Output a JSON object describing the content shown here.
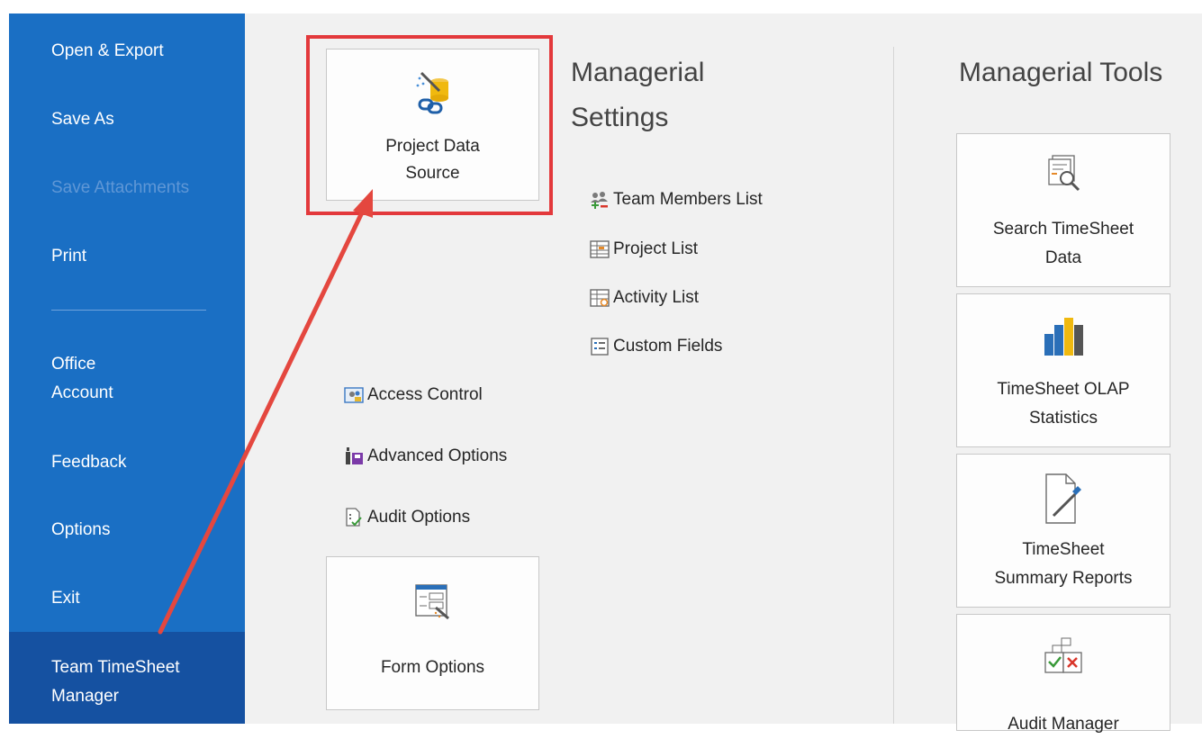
{
  "sidebar": {
    "items": [
      {
        "label": "Open & Export",
        "enabled": true
      },
      {
        "label": "Save As",
        "enabled": true
      },
      {
        "label": "Save Attachments",
        "enabled": false
      },
      {
        "label": "Print",
        "enabled": true
      },
      {
        "label": "Office",
        "enabled": true
      },
      {
        "label": "Account",
        "enabled": true
      },
      {
        "label": "Feedback",
        "enabled": true
      },
      {
        "label": "Options",
        "enabled": true
      },
      {
        "label": "Exit",
        "enabled": true
      },
      {
        "label": "Team TimeSheet",
        "enabled": true,
        "selected": true
      },
      {
        "label": "Manager",
        "enabled": true,
        "selected": true
      }
    ],
    "colors": {
      "background": "#1a6fc4",
      "selected": "#1551a1",
      "disabled_text": "#5f97d6"
    }
  },
  "settings": {
    "title_line1": "Managerial",
    "title_line2": "Settings",
    "project_data_source": {
      "line1": "Project Data",
      "line2": "Source",
      "icon": "database-link-icon"
    },
    "links": [
      {
        "label": "Team Members List",
        "icon": "team-members-icon"
      },
      {
        "label": "Project List",
        "icon": "project-list-icon"
      },
      {
        "label": "Activity List",
        "icon": "activity-list-icon"
      },
      {
        "label": "Custom Fields",
        "icon": "custom-fields-icon"
      }
    ],
    "options": [
      {
        "label": "Access Control",
        "icon": "access-control-icon"
      },
      {
        "label": "Advanced Options",
        "icon": "advanced-options-icon"
      },
      {
        "label": "Audit Options",
        "icon": "audit-options-icon"
      }
    ],
    "form_options": {
      "label": "Form Options",
      "icon": "form-options-icon"
    }
  },
  "tools": {
    "title": "Managerial Tools",
    "tiles": [
      {
        "line1": "Search TimeSheet",
        "line2": "Data",
        "icon": "search-data-icon"
      },
      {
        "line1": "TimeSheet OLAP",
        "line2": "Statistics",
        "icon": "bar-chart-icon"
      },
      {
        "line1": "TimeSheet",
        "line2": "Summary Reports",
        "icon": "report-pen-icon"
      },
      {
        "line1": "Audit Manager",
        "line2": "",
        "icon": "audit-manager-icon"
      }
    ]
  },
  "annotation": {
    "highlight_color": "#e3393c",
    "arrow_color": "#e4473f"
  }
}
